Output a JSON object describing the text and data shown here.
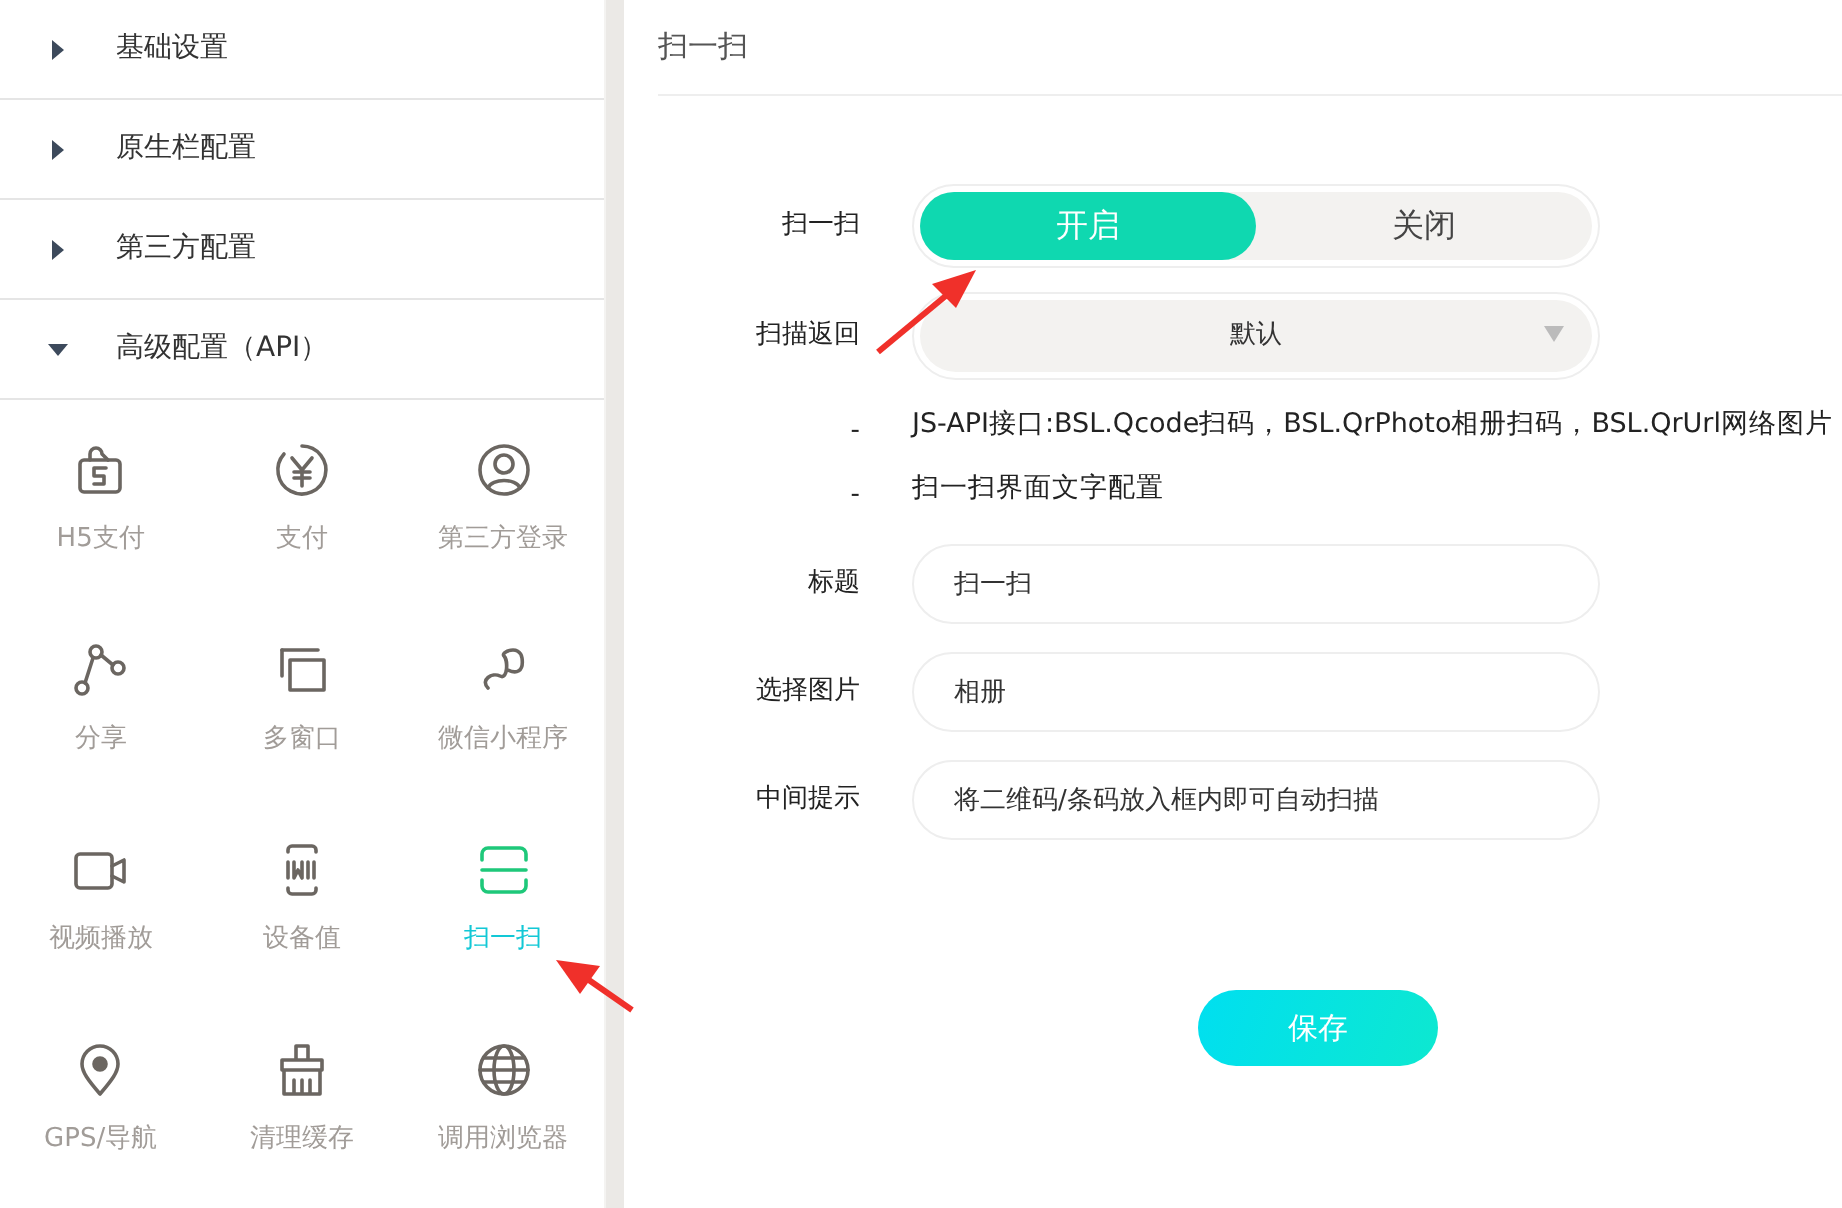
{
  "sidebar": {
    "sections": [
      {
        "label": "基础设置",
        "expanded": false
      },
      {
        "label": "原生栏配置",
        "expanded": false
      },
      {
        "label": "第三方配置",
        "expanded": false
      },
      {
        "label": "高级配置（API）",
        "expanded": true
      }
    ],
    "tiles": [
      {
        "kind": "h5pay",
        "label": "H5支付",
        "selected": false
      },
      {
        "kind": "yen",
        "label": "支付",
        "selected": false
      },
      {
        "kind": "user",
        "label": "第三方登录",
        "selected": false
      },
      {
        "kind": "share",
        "label": "分享",
        "selected": false
      },
      {
        "kind": "windows",
        "label": "多窗口",
        "selected": false
      },
      {
        "kind": "miniprogram",
        "label": "微信小程序",
        "selected": false
      },
      {
        "kind": "video",
        "label": "视频播放",
        "selected": false
      },
      {
        "kind": "device",
        "label": "设备值",
        "selected": false
      },
      {
        "kind": "scan",
        "label": "扫一扫",
        "selected": true
      },
      {
        "kind": "pin",
        "label": "GPS/导航",
        "selected": false
      },
      {
        "kind": "broom",
        "label": "清理缓存",
        "selected": false
      },
      {
        "kind": "globe",
        "label": "调用浏览器",
        "selected": false
      }
    ]
  },
  "main": {
    "title": "扫一扫",
    "toggle": {
      "label": "扫一扫",
      "options": [
        {
          "label": "开启",
          "selected": true
        },
        {
          "label": "关闭",
          "selected": false
        }
      ]
    },
    "select": {
      "label": "扫描返回",
      "value": "默认"
    },
    "notes": [
      {
        "label": "-",
        "text": "JS-API接口:BSL.Qcode扫码，BSL.QrPhoto相册扫码，BSL.QrUrl网络图片"
      },
      {
        "label": "-",
        "text": "扫一扫界面文字配置"
      }
    ],
    "fields": [
      {
        "label": "标题",
        "value": "扫一扫"
      },
      {
        "label": "选择图片",
        "value": "相册"
      },
      {
        "label": "中间提示",
        "value": "将二维码/条码放入框内即可自动扫描"
      }
    ],
    "save": "保存"
  }
}
